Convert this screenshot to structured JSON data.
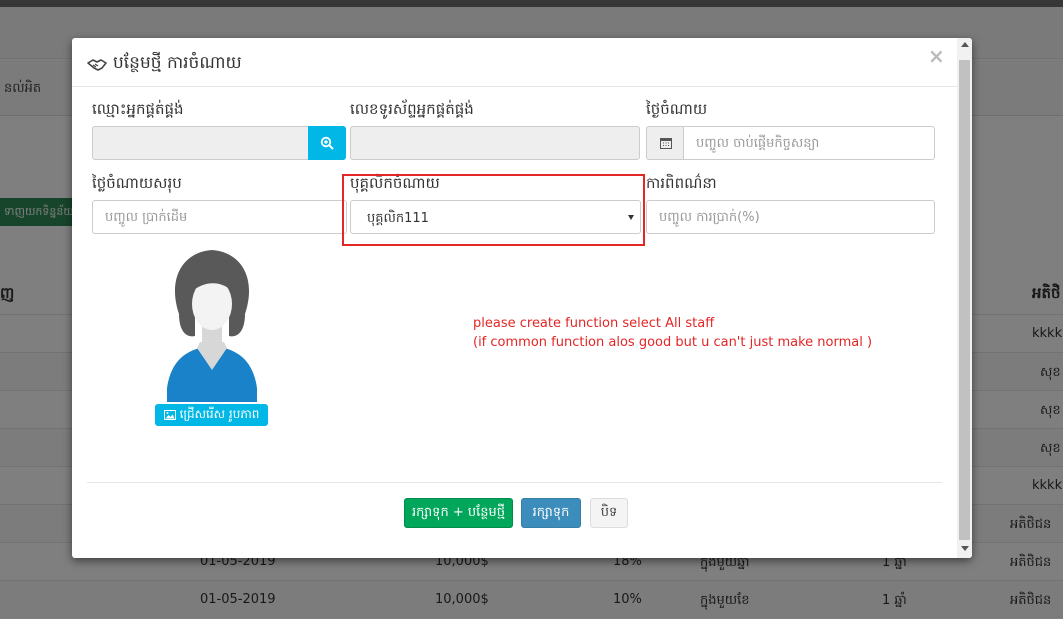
{
  "background": {
    "nav_label": "នល់អិត",
    "green_button": "ទាញយកទិន្នន័យ",
    "table_header_left": "ញ",
    "table_header_right": "អតិថិ",
    "right_column": [
      "kkkkk",
      "សុខ",
      "សុខ",
      "សុខ",
      "kkkkk",
      "អតិថិជន"
    ],
    "rows": [
      {
        "date": "01-05-2019",
        "amount": "10,000$",
        "rate": "18%",
        "period": "ក្នុងមួយឆ្នាំ",
        "duration": "1 ឆ្នាំ",
        "type": "អតិថិជន"
      },
      {
        "date": "01-05-2019",
        "amount": "10,000$",
        "rate": "10%",
        "period": "ក្នុងមួយខែ",
        "duration": "1 ឆ្នាំ",
        "type": "អតិថិជន"
      }
    ]
  },
  "modal": {
    "title": "បន្ថែមថ្មី ការចំណាយ",
    "close_label": "×",
    "fields": {
      "supplier_name": {
        "label": "ឈ្មោះអ្នកផ្គត់ផ្គង់",
        "value": ""
      },
      "supplier_phone": {
        "label": "លេខទូរស័ព្ទអ្នកផ្គត់ផ្គង់",
        "value": ""
      },
      "expense_date": {
        "label": "ថ្ងៃចំណាយ",
        "placeholder": "បញ្ចូល ចាប់ផ្តើមកិច្ចសន្យា"
      },
      "total_expense": {
        "label": "ថ្លៃចំណាយសរុប",
        "placeholder": "បញ្ចូល ប្រាក់ដើម"
      },
      "expense_staff": {
        "label": "បុគ្គលិកចំណាយ",
        "selected": "បុគ្គលិក111"
      },
      "interest": {
        "label": "ការពិពណ៌នា",
        "placeholder": "បញ្ចូល ការប្រាក់(%)"
      }
    },
    "choose_photo_label": "ជ្រើសរើស រូបភាព",
    "note_lines": [
      "please create function select All staff",
      "(if common function alos good but u can't just make normal )"
    ],
    "buttons": {
      "save_new": "រក្សាទុក + បន្ថែមថ្មី",
      "save": "រក្សាទុក",
      "close": "បិទ"
    }
  },
  "colors": {
    "accent_cyan": "#00b7e6",
    "success_green": "#00a65a",
    "primary_blue": "#3c8dbc",
    "annotation_red": "#e32626"
  }
}
